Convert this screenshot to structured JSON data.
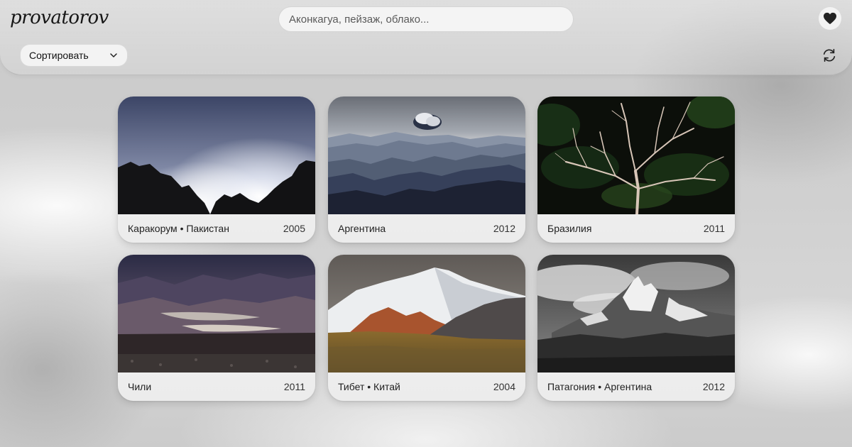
{
  "header": {
    "logo": "provatorov",
    "search_placeholder": "Аконкагуа, пейзаж, облако...",
    "favorites_icon": "heart-icon",
    "sort_label": "Сортировать",
    "sort_icon": "chevron-down-icon",
    "refresh_icon": "refresh-icon"
  },
  "gallery": [
    {
      "caption": "Каракорум • Пакистан",
      "year": "2005"
    },
    {
      "caption": "Аргентина",
      "year": "2012"
    },
    {
      "caption": "Бразилия",
      "year": "2011"
    },
    {
      "caption": "Чили",
      "year": "2011"
    },
    {
      "caption": "Тибет • Китай",
      "year": "2004"
    },
    {
      "caption": "Патагония • Аргентина",
      "year": "2012"
    }
  ]
}
